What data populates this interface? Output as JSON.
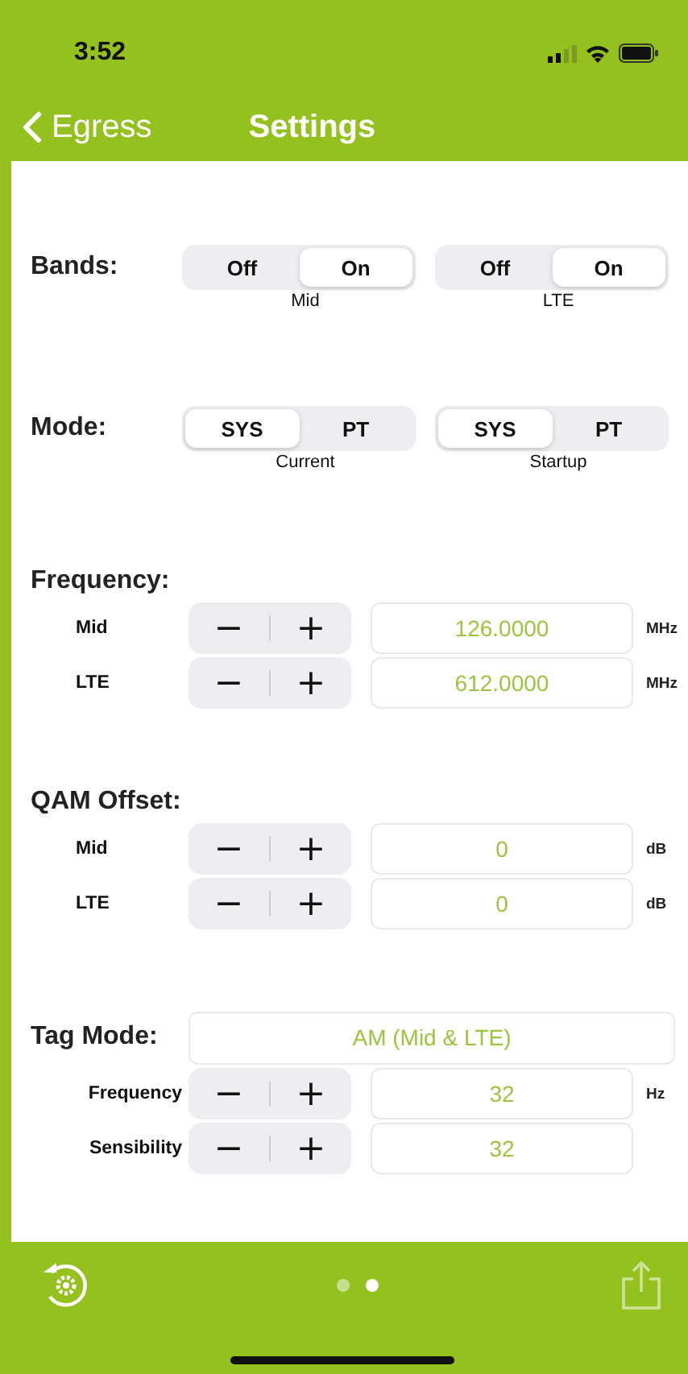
{
  "status_bar": {
    "time": "3:52"
  },
  "nav_bar": {
    "back_label": "Egress",
    "title": "Settings"
  },
  "sections": [
    {
      "kind": "segments",
      "label": "Bands:",
      "controls": [
        {
          "caption": "Mid",
          "options": [
            {
              "label": "Off",
              "selected": false
            },
            {
              "label": "On",
              "selected": true
            }
          ]
        },
        {
          "caption": "LTE",
          "options": [
            {
              "label": "Off",
              "selected": false
            },
            {
              "label": "On",
              "selected": true
            }
          ]
        }
      ]
    },
    {
      "kind": "segments",
      "label": "Mode:",
      "controls": [
        {
          "caption": "Current",
          "options": [
            {
              "label": "SYS",
              "selected": true
            },
            {
              "label": "PT",
              "selected": false
            }
          ]
        },
        {
          "caption": "Startup",
          "options": [
            {
              "label": "SYS",
              "selected": true
            },
            {
              "label": "PT",
              "selected": false
            }
          ]
        }
      ]
    },
    {
      "kind": "steppers",
      "label": "Frequency:",
      "rows": [
        {
          "label": "Mid",
          "decrement": "−",
          "increment": "+",
          "value": "126.0000",
          "unit": "MHz"
        },
        {
          "label": "LTE",
          "decrement": "−",
          "increment": "+",
          "value": "612.0000",
          "unit": "MHz"
        }
      ]
    },
    {
      "kind": "steppers",
      "label": "QAM Offset:",
      "rows": [
        {
          "label": "Mid",
          "decrement": "−",
          "increment": "+",
          "value": "0",
          "unit": "dB"
        },
        {
          "label": "LTE",
          "decrement": "−",
          "increment": "+",
          "value": "0",
          "unit": "dB"
        }
      ]
    },
    {
      "kind": "picker",
      "label": "Tag Mode:",
      "value": "AM (Mid & LTE)",
      "rows": [
        {
          "label": "Frequency",
          "decrement": "−",
          "increment": "+",
          "value": "32",
          "unit": "Hz"
        },
        {
          "label": "Sensibility",
          "decrement": "−",
          "increment": "+",
          "value": "32"
        }
      ]
    }
  ],
  "page_dots": [
    {
      "selected": false
    },
    {
      "selected": true
    }
  ]
}
